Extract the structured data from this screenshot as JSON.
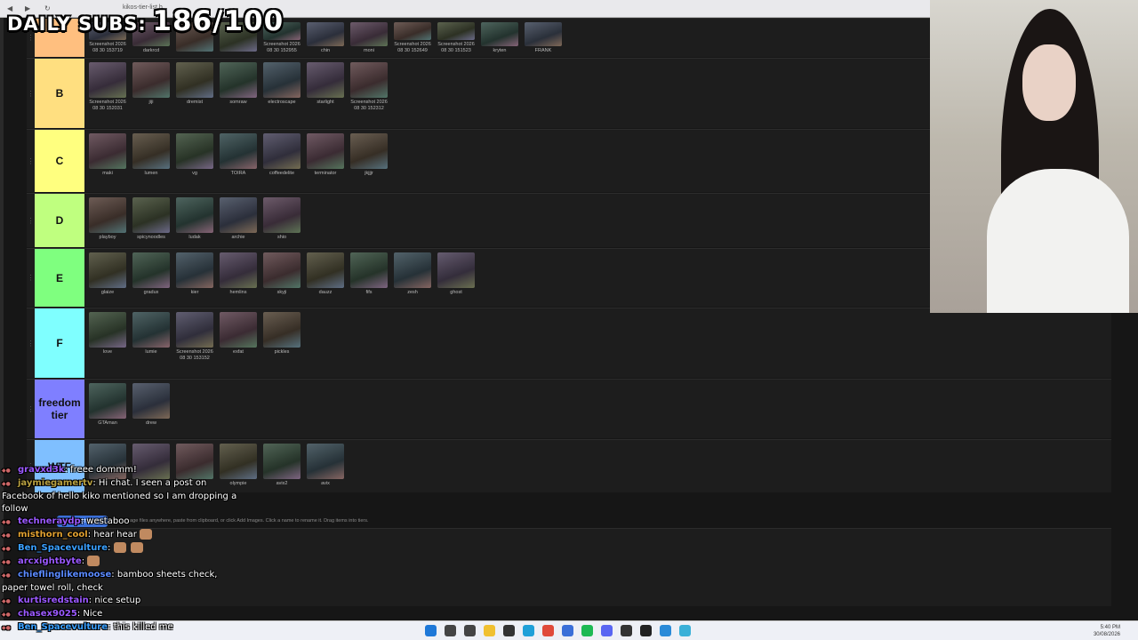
{
  "browser": {
    "tab_title": "kikos-tier-list.b...",
    "nav_icons": [
      "back-icon",
      "forward-icon",
      "refresh-icon"
    ]
  },
  "overlay": {
    "label": "DAILY SUBS:",
    "count": "186/100"
  },
  "tiers": [
    {
      "label": "",
      "color": "#ffbf7f",
      "items": [
        "Screenshot 2026 08 30 153719",
        "darkrcd",
        "",
        "",
        "Screenshot 2026 08 30 152955",
        "chin",
        "moni",
        "Screenshot 2026 08 30 152649",
        "Screenshot 2026 08 30 151523",
        "kryten",
        "FRANK"
      ]
    },
    {
      "label": "B",
      "color": "#ffdf80",
      "items": [
        "Screenshot 2026 08 30 152031",
        "jiji",
        "dremist",
        "somraw",
        "electroscape",
        "starlight",
        "Screenshot 2026 08 30 152312"
      ]
    },
    {
      "label": "C",
      "color": "#ffff7f",
      "items": [
        "maki",
        "lumen",
        "vg",
        "TOIRA",
        "coffeedelite",
        "terminator",
        "jkjjjr"
      ]
    },
    {
      "label": "D",
      "color": "#bfff7f",
      "items": [
        "playboy",
        "spicynoodles",
        "ludak",
        "archie",
        "shio"
      ]
    },
    {
      "label": "E",
      "color": "#7fff7f",
      "items": [
        "glaize",
        "gradux",
        "kier",
        "hemlins",
        "skyji",
        "dauzz",
        "fifs",
        "zesh",
        "ghost"
      ]
    },
    {
      "label": "F",
      "color": "#7fffff",
      "items": [
        "love",
        "lumie",
        "Screenshot 2026 08 30 153152",
        "exfat",
        "pickles"
      ]
    },
    {
      "label": "freedom tier",
      "color": "#7f7fff",
      "items": [
        "GTAman",
        "drew"
      ]
    },
    {
      "label": "WTF",
      "color": "#7fbfff",
      "items": [
        "",
        "",
        "",
        "olympie",
        "avix2",
        "avix"
      ]
    }
  ],
  "bench": {
    "bench_label": "Bench",
    "add_label": "+ Add Images",
    "hint": "Drop image files anywhere, paste from clipboard, or click Add Images. Click a name to rename it. Drag items into tiers."
  },
  "chat": [
    {
      "user": "gravxd3k",
      "color": "#9b59ff",
      "text": ": freee dommm!",
      "emotes": 0
    },
    {
      "user": "jaymiegamertv",
      "color": "#b8a040",
      "text": ": Hi chat. I seen a post on Facebook of hello kiko mentioned so I am dropping a follow",
      "emotes": 0
    },
    {
      "user": "techneraydp",
      "color": "#9b59ff",
      "text": ": westaboo",
      "emotes": 0
    },
    {
      "user": "misthorn_cool",
      "color": "#e0a030",
      "text": ": hear hear",
      "emotes": 1
    },
    {
      "user": "Ben_Spacevulture",
      "color": "#3aa0ff",
      "text": ":",
      "emotes": 2
    },
    {
      "user": "arcxightbyte",
      "color": "#9b59ff",
      "text": ":",
      "emotes": 1
    },
    {
      "user": "chieflinglikemoose",
      "color": "#5a8aff",
      "text": ": bamboo sheets check, paper towel roll, check",
      "emotes": 0
    },
    {
      "user": "kurtisredstain",
      "color": "#9b59ff",
      "text": ": nice setup",
      "emotes": 0
    },
    {
      "user": "chasex9025",
      "color": "#9b59ff",
      "text": ": Nice",
      "emotes": 0
    },
    {
      "user": "Ben_Spacevulture",
      "color": "#3aa0ff",
      "text": ": this killed me",
      "emotes": 0
    }
  ],
  "taskbar": {
    "icons": [
      {
        "name": "windows-start-icon",
        "color": "#1e78d8"
      },
      {
        "name": "search-icon",
        "color": "#444"
      },
      {
        "name": "task-view-icon",
        "color": "#444"
      },
      {
        "name": "file-explorer-icon",
        "color": "#f0c030"
      },
      {
        "name": "obs-icon",
        "color": "#333"
      },
      {
        "name": "edge-icon",
        "color": "#1fa0d8"
      },
      {
        "name": "chrome-icon",
        "color": "#e04a3a"
      },
      {
        "name": "app-icon",
        "color": "#3a6fd8"
      },
      {
        "name": "spotify-icon",
        "color": "#1db954"
      },
      {
        "name": "discord-icon",
        "color": "#5865f2"
      },
      {
        "name": "terminal-icon",
        "color": "#333"
      },
      {
        "name": "app2-icon",
        "color": "#222"
      },
      {
        "name": "app3-icon",
        "color": "#2a8ad8"
      },
      {
        "name": "app4-icon",
        "color": "#3ab0d8"
      }
    ],
    "time": "5:40 PM",
    "date": "30/08/2026"
  }
}
